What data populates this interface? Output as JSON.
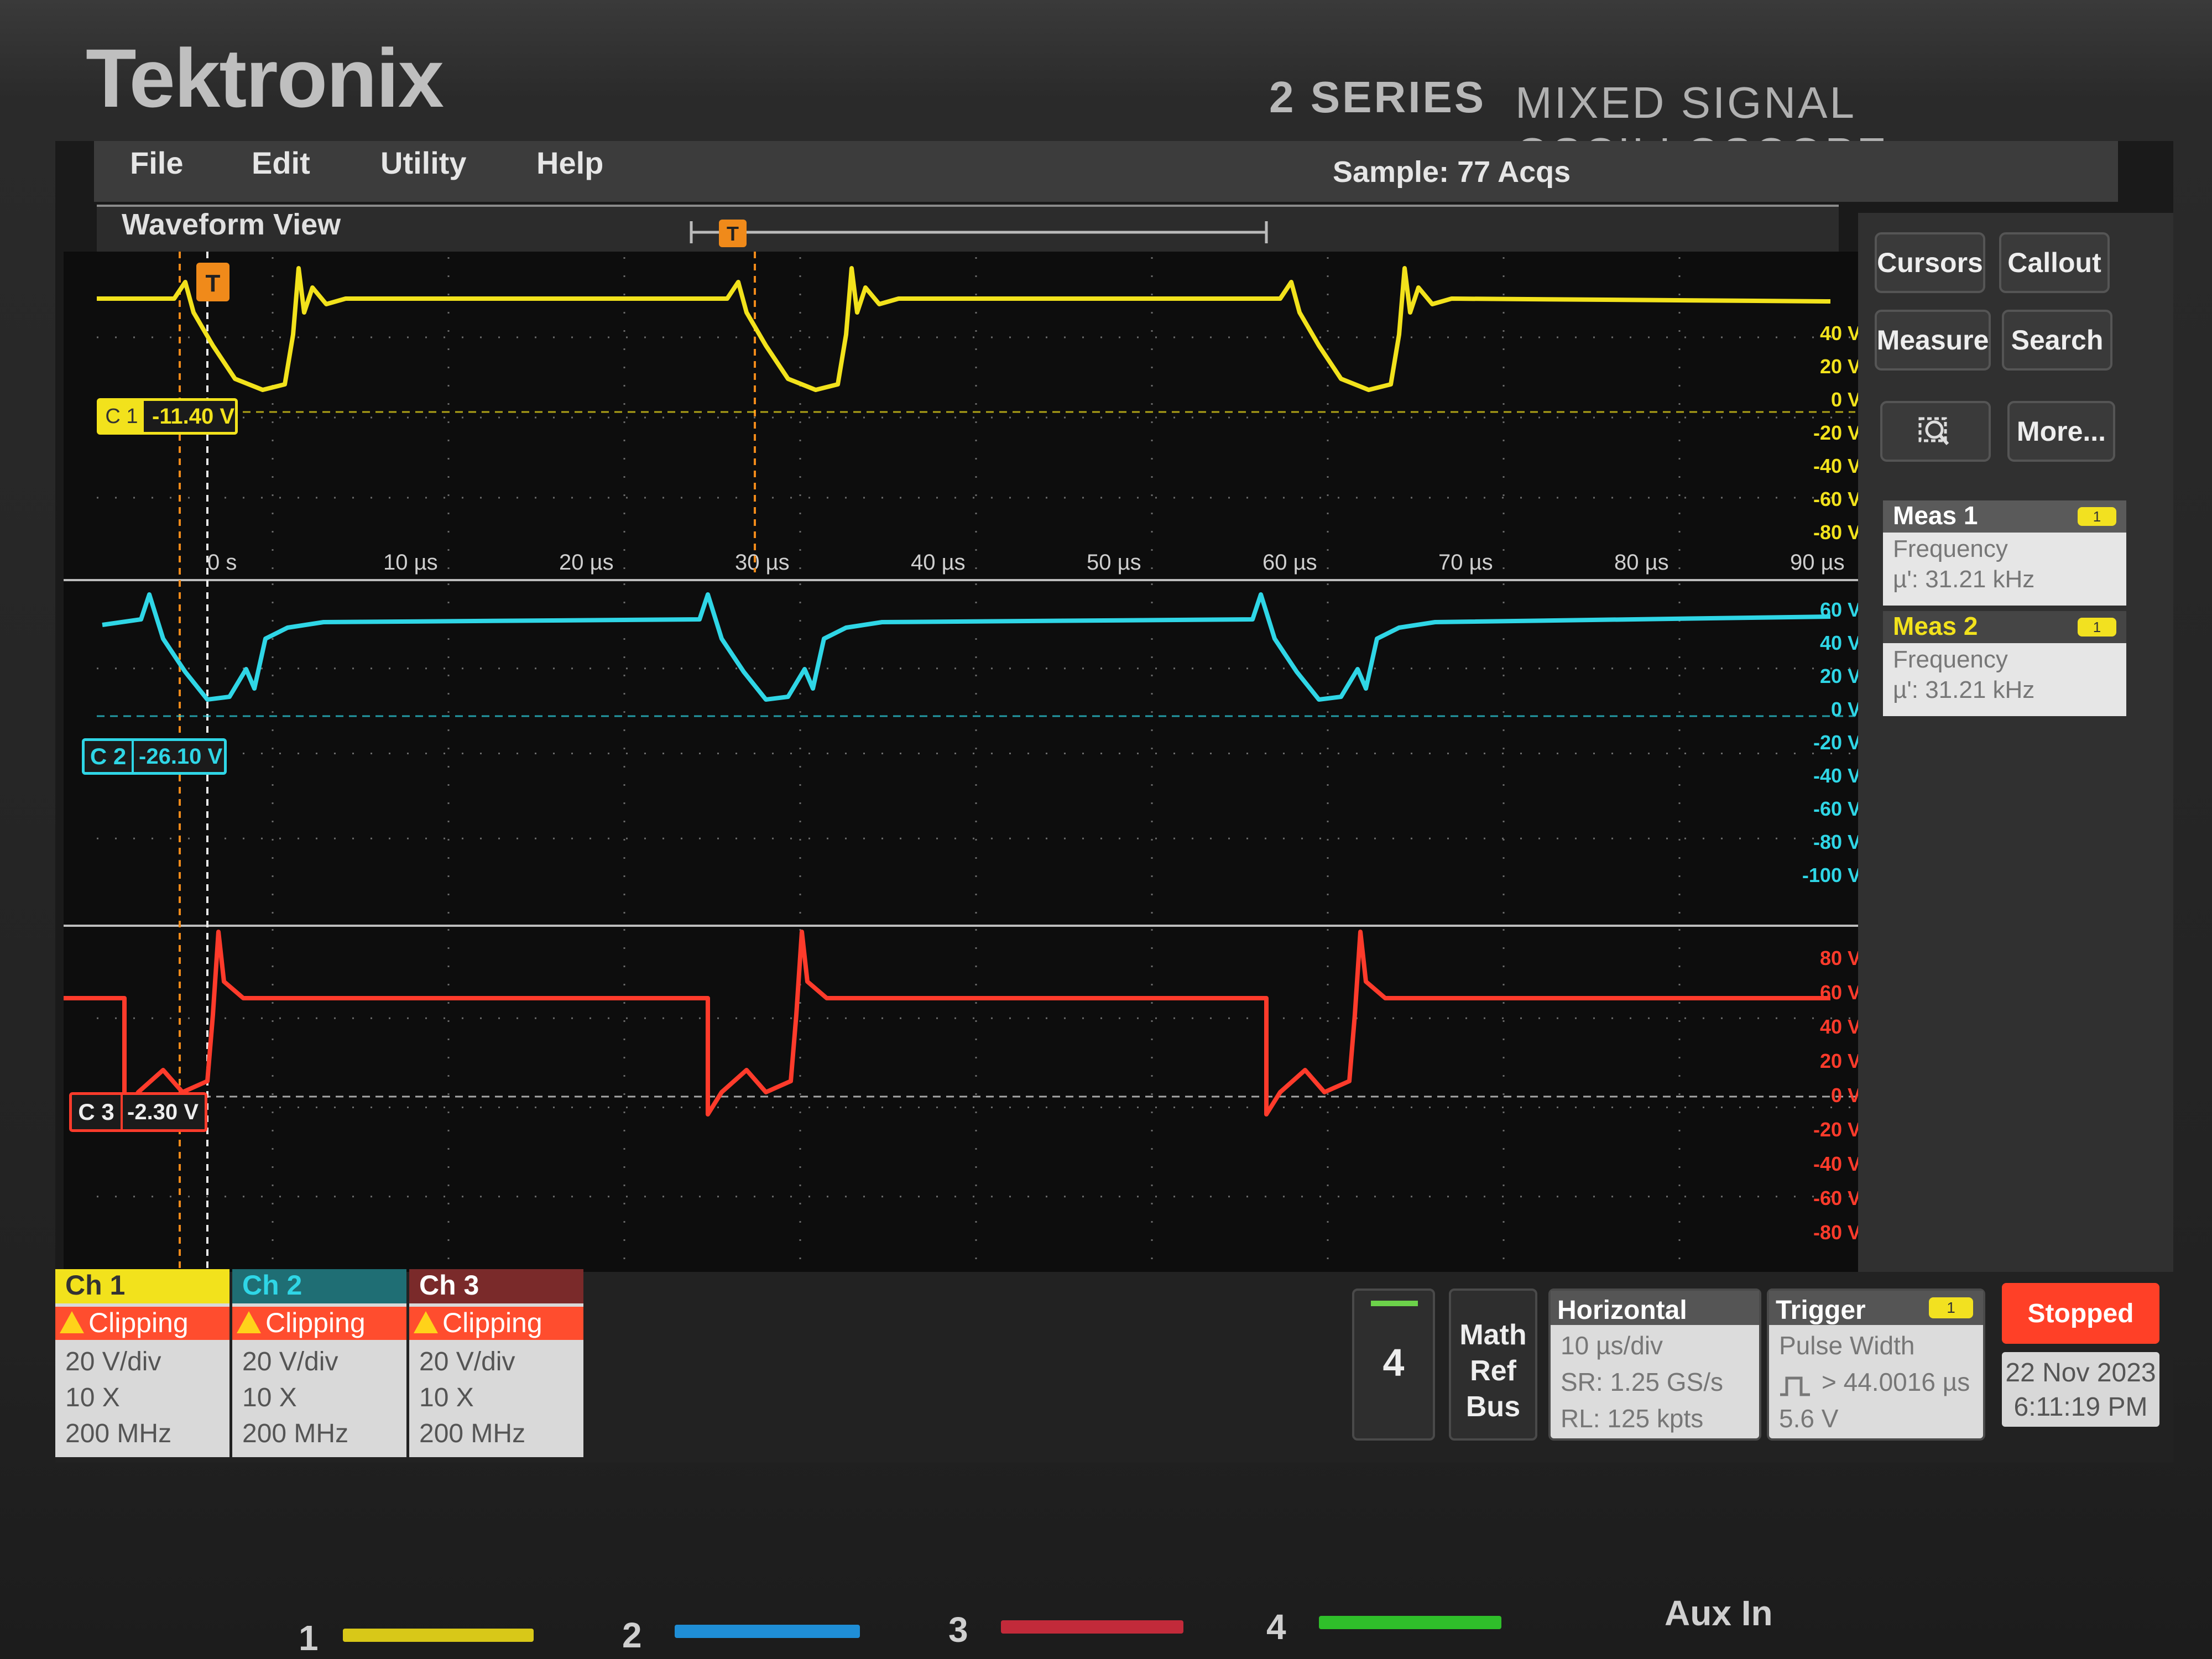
{
  "device": {
    "brand": "Tektronix",
    "series": "2 SERIES",
    "type": "MIXED SIGNAL OSCILLOSCOPE"
  },
  "menu": {
    "file": "File",
    "edit": "Edit",
    "utility": "Utility",
    "help": "Help"
  },
  "acquisition": {
    "status": "Sample: 77 Acqs"
  },
  "waveform_view": {
    "title": "Waveform View",
    "time_ticks": [
      "0 s",
      "10 µs",
      "20 µs",
      "30 µs",
      "40 µs",
      "50 µs",
      "60 µs",
      "70 µs",
      "80 µs",
      "90 µs"
    ],
    "trigger_marker": "T",
    "ch1": {
      "label": "C 1",
      "offset": "-11.40 V",
      "scale_labels": [
        "40 V",
        "20 V",
        "0 V",
        "-20 V",
        "-40 V",
        "-60 V",
        "-80 V"
      ],
      "color": "#f2e21c"
    },
    "ch2": {
      "label": "C 2",
      "offset": "-26.10 V",
      "scale_labels": [
        "60 V",
        "40 V",
        "20 V",
        "0 V",
        "-20 V",
        "-40 V",
        "-60 V",
        "-80 V",
        "-100 V"
      ],
      "color": "#2fd6e6"
    },
    "ch3": {
      "label": "C 3",
      "offset": "-2.30 V",
      "scale_labels": [
        "80 V",
        "60 V",
        "40 V",
        "20 V",
        "0 V",
        "-20 V",
        "-40 V",
        "-60 V",
        "-80 V"
      ],
      "color": "#ff3b2b"
    }
  },
  "side_panel": {
    "cursors": "Cursors",
    "callout": "Callout",
    "measure": "Measure",
    "search": "Search",
    "more": "More...",
    "meas1": {
      "title": "Meas 1",
      "badge": "1",
      "name": "Frequency",
      "value": "µ': 31.21 kHz"
    },
    "meas2": {
      "title": "Meas 2",
      "badge": "1",
      "name": "Frequency",
      "value": "µ': 31.21 kHz"
    }
  },
  "channels": [
    {
      "name": "Ch 1",
      "status": "Clipping",
      "vdiv": "20 V/div",
      "probe": "10 X",
      "bw": "200 MHz",
      "color": "#f2e21c"
    },
    {
      "name": "Ch 2",
      "status": "Clipping",
      "vdiv": "20 V/div",
      "probe": "10 X",
      "bw": "200 MHz",
      "color": "#2fd6e6"
    },
    {
      "name": "Ch 3",
      "status": "Clipping",
      "vdiv": "20 V/div",
      "probe": "10 X",
      "bw": "200 MHz",
      "color": "#ff3b2b"
    }
  ],
  "bottom": {
    "ch4_button": "4",
    "math_ref_bus": [
      "Math",
      "Ref",
      "Bus"
    ],
    "horizontal": {
      "title": "Horizontal",
      "scale": "10 µs/div",
      "sr": "SR: 1.25 GS/s",
      "rl": "RL: 125 kpts"
    },
    "trigger": {
      "title": "Trigger",
      "badge": "1",
      "type": "Pulse Width",
      "condition": "> 44.0016 µs",
      "level": "5.6 V"
    },
    "run_state": "Stopped",
    "date": "22 Nov 2023",
    "time": "6:11:19 PM"
  },
  "front_keys": {
    "k1": "1",
    "k2": "2",
    "k3": "3",
    "k4": "4",
    "aux": "Aux In"
  }
}
